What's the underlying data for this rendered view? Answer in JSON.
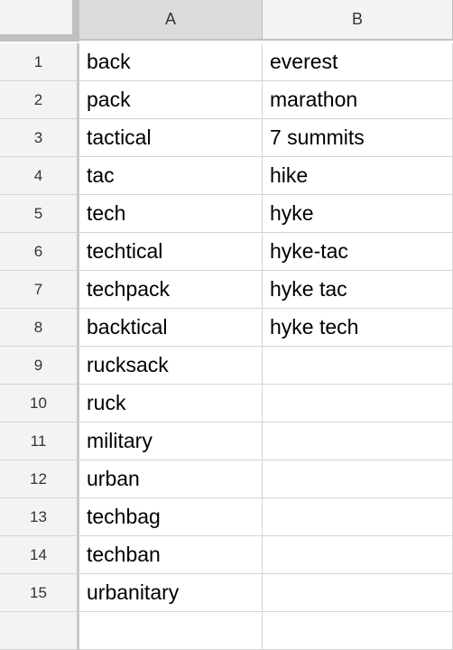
{
  "columns": [
    "A",
    "B"
  ],
  "rows": [
    {
      "num": "1",
      "a": "back",
      "b": "everest"
    },
    {
      "num": "2",
      "a": "pack",
      "b": "marathon"
    },
    {
      "num": "3",
      "a": "tactical",
      "b": "7 summits"
    },
    {
      "num": "4",
      "a": "tac",
      "b": "hike"
    },
    {
      "num": "5",
      "a": "tech",
      "b": "hyke"
    },
    {
      "num": "6",
      "a": "techtical",
      "b": "hyke-tac"
    },
    {
      "num": "7",
      "a": "techpack",
      "b": "hyke tac"
    },
    {
      "num": "8",
      "a": "backtical",
      "b": "hyke tech"
    },
    {
      "num": "9",
      "a": "rucksack",
      "b": ""
    },
    {
      "num": "10",
      "a": "ruck",
      "b": ""
    },
    {
      "num": "11",
      "a": "military",
      "b": ""
    },
    {
      "num": "12",
      "a": "urban",
      "b": ""
    },
    {
      "num": "13",
      "a": "techbag",
      "b": ""
    },
    {
      "num": "14",
      "a": "techban",
      "b": ""
    },
    {
      "num": "15",
      "a": "urbanitary",
      "b": ""
    },
    {
      "num": "",
      "a": "",
      "b": ""
    }
  ]
}
